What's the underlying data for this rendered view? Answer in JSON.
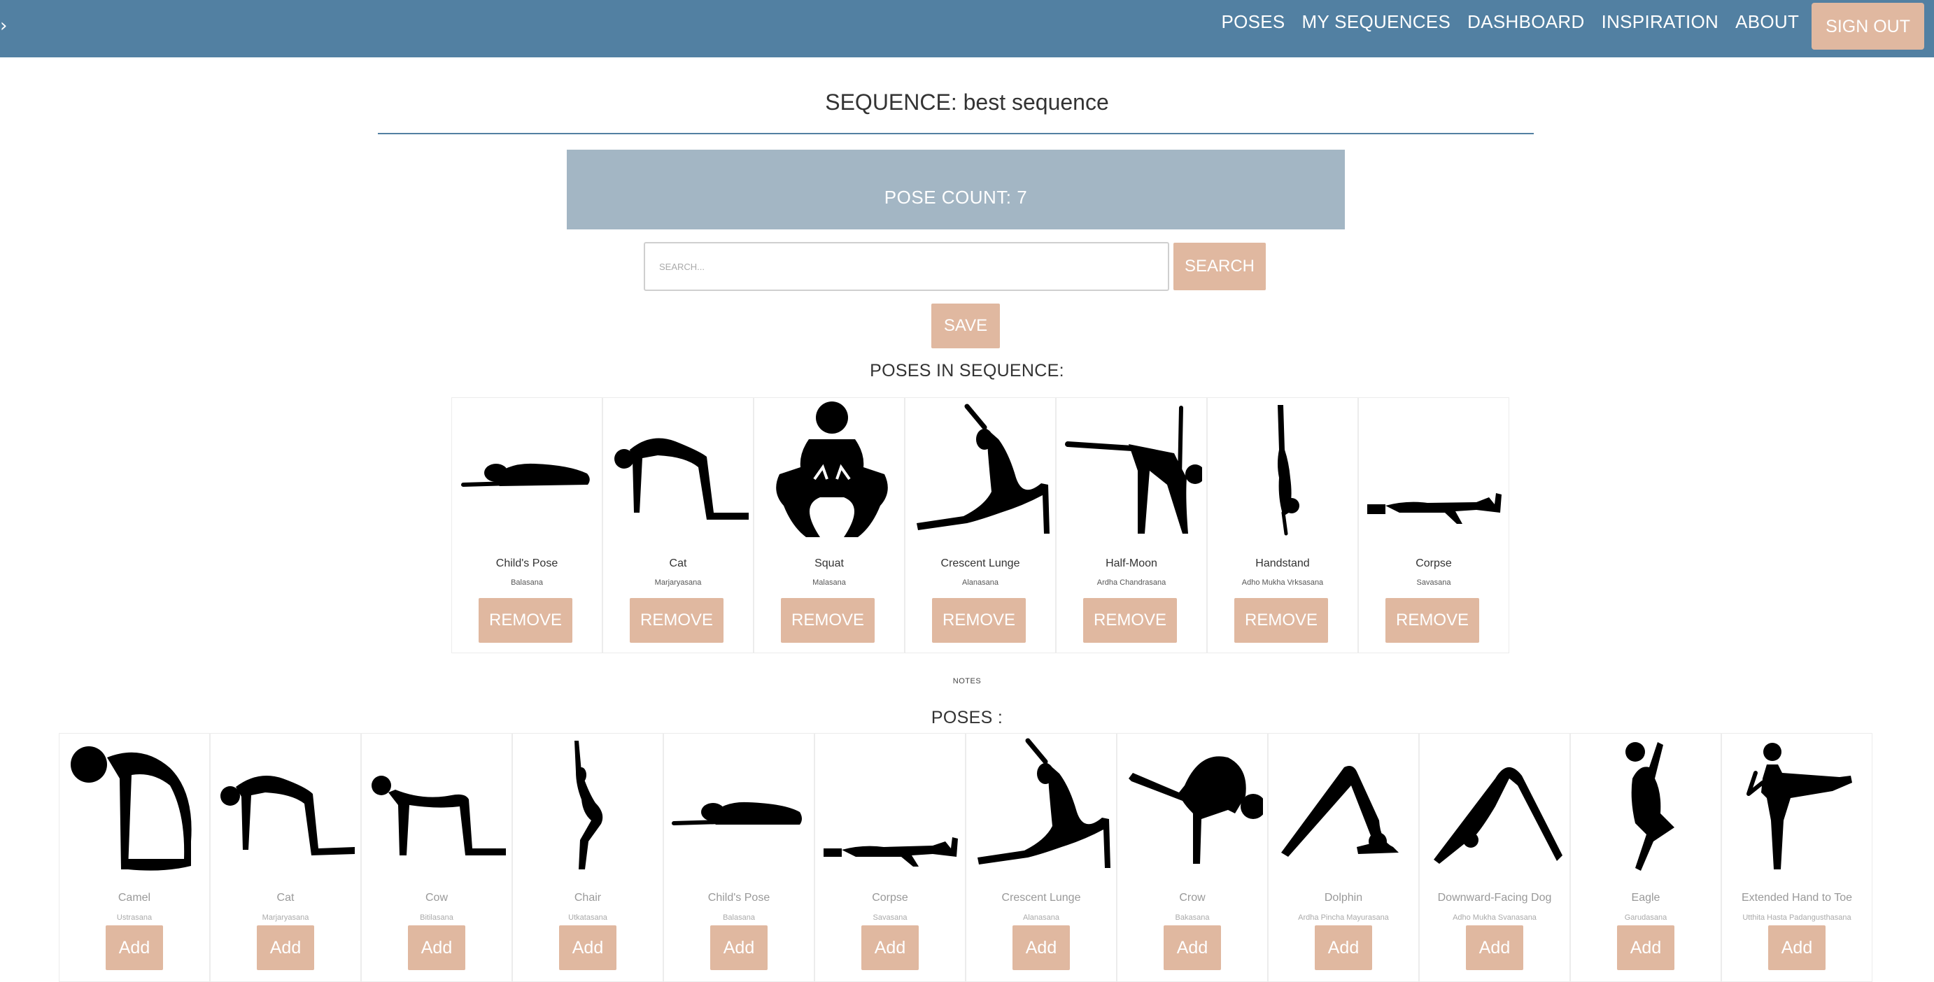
{
  "nav": {
    "caret": "›",
    "links": [
      "POSES",
      "MY SEQUENCES",
      "DASHBOARD",
      "INSPIRATION",
      "ABOUT"
    ],
    "signout": "SIGN OUT"
  },
  "sequence": {
    "title": "SEQUENCE: best sequence",
    "pose_count": "POSE COUNT: 7",
    "search_placeholder": "SEARCH...",
    "search_button": "SEARCH",
    "save_button": "SAVE",
    "poses_heading": "POSES IN SEQUENCE:",
    "remove_label": "REMOVE",
    "poses": [
      {
        "name": "Child's Pose",
        "sanskrit": "Balasana",
        "icon": "childs-pose-icon"
      },
      {
        "name": "Cat",
        "sanskrit": "Marjaryasana",
        "icon": "cat-pose-icon"
      },
      {
        "name": "Squat",
        "sanskrit": "Malasana",
        "icon": "squat-pose-icon"
      },
      {
        "name": "Crescent Lunge",
        "sanskrit": "Alanasana",
        "icon": "crescent-lunge-icon"
      },
      {
        "name": "Half-Moon",
        "sanskrit": "Ardha Chandrasana",
        "icon": "half-moon-icon"
      },
      {
        "name": "Handstand",
        "sanskrit": "Adho Mukha Vrksasana",
        "icon": "handstand-icon"
      },
      {
        "name": "Corpse",
        "sanskrit": "Savasana",
        "icon": "corpse-pose-icon"
      }
    ],
    "notes_label": "NOTES"
  },
  "library": {
    "heading": "POSES :",
    "add_label": "Add",
    "poses": [
      {
        "name": "Camel",
        "sanskrit": "Ustrasana",
        "icon": "camel-pose-icon"
      },
      {
        "name": "Cat",
        "sanskrit": "Marjaryasana",
        "icon": "cat-pose-icon"
      },
      {
        "name": "Cow",
        "sanskrit": "Bitilasana",
        "icon": "cow-pose-icon"
      },
      {
        "name": "Chair",
        "sanskrit": "Utkatasana",
        "icon": "chair-pose-icon"
      },
      {
        "name": "Child's Pose",
        "sanskrit": "Balasana",
        "icon": "childs-pose-icon"
      },
      {
        "name": "Corpse",
        "sanskrit": "Savasana",
        "icon": "corpse-pose-icon"
      },
      {
        "name": "Crescent Lunge",
        "sanskrit": "Alanasana",
        "icon": "crescent-lunge-icon"
      },
      {
        "name": "Crow",
        "sanskrit": "Bakasana",
        "icon": "crow-pose-icon"
      },
      {
        "name": "Dolphin",
        "sanskrit": "Ardha Pincha Mayurasana",
        "icon": "dolphin-pose-icon"
      },
      {
        "name": "Downward-Facing Dog",
        "sanskrit": "Adho Mukha Svanasana",
        "icon": "downward-dog-icon"
      },
      {
        "name": "Eagle",
        "sanskrit": "Garudasana",
        "icon": "eagle-pose-icon"
      },
      {
        "name": "Extended Hand to Toe",
        "sanskrit": "Utthita Hasta Padangusthasana",
        "icon": "extended-hand-to-toe-icon"
      }
    ]
  },
  "colors": {
    "navbar": "#5280a2",
    "button": "#e0b8a0",
    "count_box": "#a3b6c4"
  }
}
